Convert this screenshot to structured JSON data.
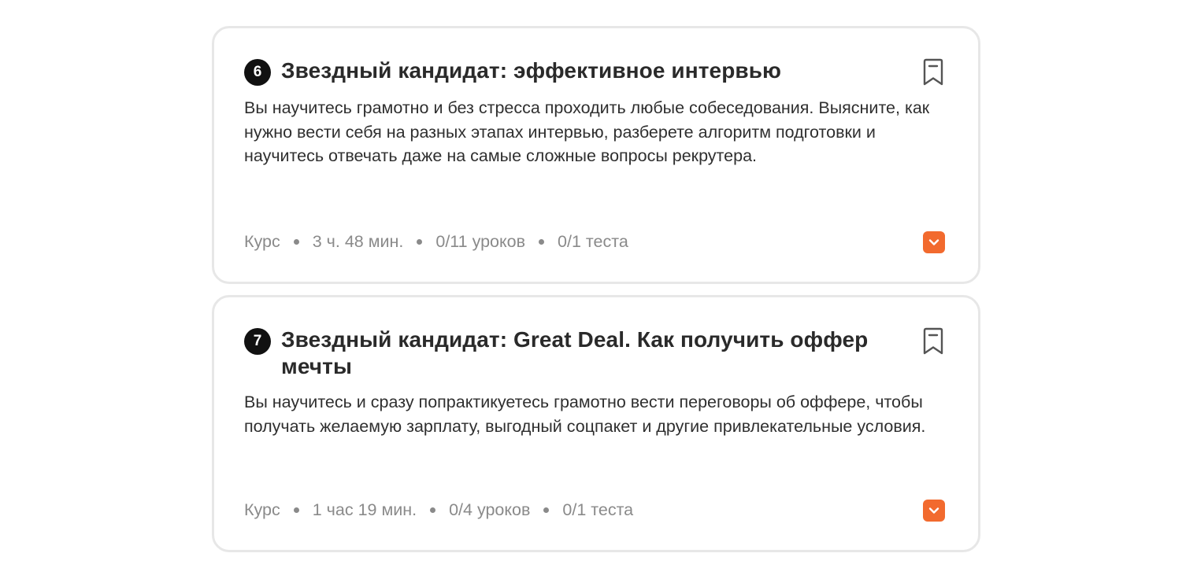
{
  "courses": [
    {
      "number": "6",
      "title": "Звездный кандидат: эффективное интервью",
      "description": "Вы научитесь грамотно и без стресса проходить любые собеседования. Выясните, как нужно вести себя на разных этапах интервью, разберете алгоритм подготовки и научитесь отвечать даже на самые сложные вопросы рекрутера.",
      "type": "Курс",
      "duration": "3 ч. 48 мин.",
      "lessons": "0/11 уроков",
      "tests": "0/1 теста"
    },
    {
      "number": "7",
      "title": "Звездный кандидат: Great Deal. Как получить оффер мечты",
      "description": "Вы научитесь и сразу попрактикуетесь грамотно вести переговоры об оффере, чтобы получать желаемую зарплату, выгодный соцпакет и другие привлекательные условия.",
      "type": "Курс",
      "duration": "1 час 19 мин.",
      "lessons": "0/4 уроков",
      "tests": "0/1 теста"
    }
  ],
  "icons": {
    "bookmark": "bookmark-icon",
    "expand": "chevron-down-icon"
  },
  "colors": {
    "accent": "#f26a2e",
    "number_badge": "#111111",
    "card_border": "#e7e7e7",
    "meta_text": "#8a8a8a"
  }
}
